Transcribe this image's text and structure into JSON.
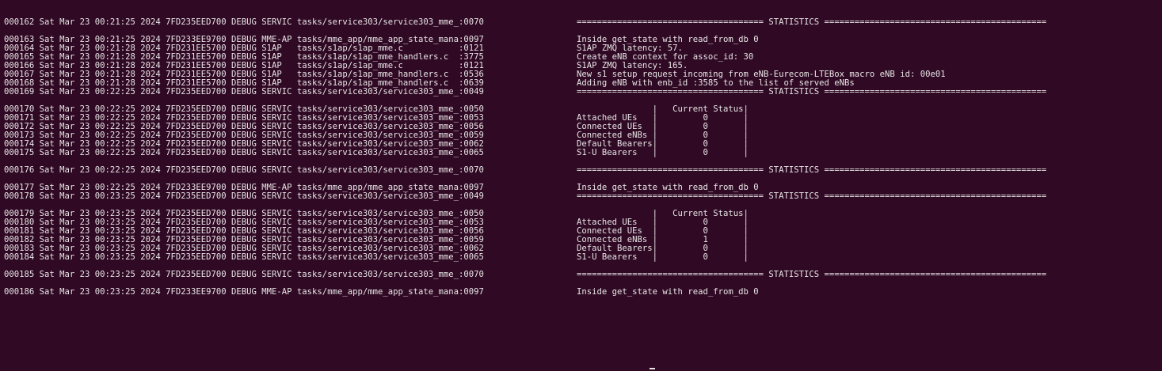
{
  "terminal": {
    "lines": [
      {
        "prefix": "000162 Sat Mar 23 00:21:25 2024 7FD235EED700 DEBUG SERVIC tasks/service303/service303_mme_:0070",
        "msg": "===================================== STATISTICS ============================================"
      },
      {
        "prefix": "",
        "msg": ""
      },
      {
        "prefix": "000163 Sat Mar 23 00:21:25 2024 7FD233EE9700 DEBUG MME-AP tasks/mme_app/mme_app_state_mana:0097",
        "msg": "Inside get_state with read_from_db 0"
      },
      {
        "prefix": "000164 Sat Mar 23 00:21:28 2024 7FD231EE5700 DEBUG S1AP   tasks/s1ap/s1ap_mme.c           :0121",
        "msg": "S1AP ZMQ latency: 57."
      },
      {
        "prefix": "000165 Sat Mar 23 00:21:28 2024 7FD231EE5700 DEBUG S1AP   tasks/s1ap/s1ap_mme_handlers.c  :3775",
        "msg": "Create eNB context for assoc_id: 30"
      },
      {
        "prefix": "000166 Sat Mar 23 00:21:28 2024 7FD231EE5700 DEBUG S1AP   tasks/s1ap/s1ap_mme.c           :0121",
        "msg": "S1AP ZMQ latency: 165."
      },
      {
        "prefix": "000167 Sat Mar 23 00:21:28 2024 7FD231EE5700 DEBUG S1AP   tasks/s1ap/s1ap_mme_handlers.c  :0536",
        "msg": "New s1 setup request incoming from eNB-Eurecom-LTEBox macro eNB id: 00e01"
      },
      {
        "prefix": "000168 Sat Mar 23 00:21:28 2024 7FD231EE5700 DEBUG S1AP   tasks/s1ap/s1ap_mme_handlers.c  :0639",
        "msg": "Adding eNB with enb_id :3585 to the list of served eNBs"
      },
      {
        "prefix": "000169 Sat Mar 23 00:22:25 2024 7FD235EED700 DEBUG SERVIC tasks/service303/service303_mme_:0049",
        "msg": "===================================== STATISTICS ============================================"
      },
      {
        "prefix": "",
        "msg": ""
      },
      {
        "prefix": "000170 Sat Mar 23 00:22:25 2024 7FD235EED700 DEBUG SERVIC tasks/service303/service303_mme_:0050",
        "msg": "               |   Current Status|"
      },
      {
        "prefix": "000171 Sat Mar 23 00:22:25 2024 7FD235EED700 DEBUG SERVIC tasks/service303/service303_mme_:0053",
        "msg": "Attached UEs   |         0       |"
      },
      {
        "prefix": "000172 Sat Mar 23 00:22:25 2024 7FD235EED700 DEBUG SERVIC tasks/service303/service303_mme_:0056",
        "msg": "Connected UEs  |         0       |"
      },
      {
        "prefix": "000173 Sat Mar 23 00:22:25 2024 7FD235EED700 DEBUG SERVIC tasks/service303/service303_mme_:0059",
        "msg": "Connected eNBs |         0       |"
      },
      {
        "prefix": "000174 Sat Mar 23 00:22:25 2024 7FD235EED700 DEBUG SERVIC tasks/service303/service303_mme_:0062",
        "msg": "Default Bearers|         0       |"
      },
      {
        "prefix": "000175 Sat Mar 23 00:22:25 2024 7FD235EED700 DEBUG SERVIC tasks/service303/service303_mme_:0065",
        "msg": "S1-U Bearers   |         0       |"
      },
      {
        "prefix": "",
        "msg": ""
      },
      {
        "prefix": "000176 Sat Mar 23 00:22:25 2024 7FD235EED700 DEBUG SERVIC tasks/service303/service303_mme_:0070",
        "msg": "===================================== STATISTICS ============================================"
      },
      {
        "prefix": "",
        "msg": ""
      },
      {
        "prefix": "000177 Sat Mar 23 00:22:25 2024 7FD233EE9700 DEBUG MME-AP tasks/mme_app/mme_app_state_mana:0097",
        "msg": "Inside get_state with read_from_db 0"
      },
      {
        "prefix": "000178 Sat Mar 23 00:23:25 2024 7FD235EED700 DEBUG SERVIC tasks/service303/service303_mme_:0049",
        "msg": "===================================== STATISTICS ============================================"
      },
      {
        "prefix": "",
        "msg": ""
      },
      {
        "prefix": "000179 Sat Mar 23 00:23:25 2024 7FD235EED700 DEBUG SERVIC tasks/service303/service303_mme_:0050",
        "msg": "               |   Current Status|"
      },
      {
        "prefix": "000180 Sat Mar 23 00:23:25 2024 7FD235EED700 DEBUG SERVIC tasks/service303/service303_mme_:0053",
        "msg": "Attached UEs   |         0       |"
      },
      {
        "prefix": "000181 Sat Mar 23 00:23:25 2024 7FD235EED700 DEBUG SERVIC tasks/service303/service303_mme_:0056",
        "msg": "Connected UEs  |         0       |"
      },
      {
        "prefix": "000182 Sat Mar 23 00:23:25 2024 7FD235EED700 DEBUG SERVIC tasks/service303/service303_mme_:0059",
        "msg": "Connected eNBs |         1       |"
      },
      {
        "prefix": "000183 Sat Mar 23 00:23:25 2024 7FD235EED700 DEBUG SERVIC tasks/service303/service303_mme_:0062",
        "msg": "Default Bearers|         0       |"
      },
      {
        "prefix": "000184 Sat Mar 23 00:23:25 2024 7FD235EED700 DEBUG SERVIC tasks/service303/service303_mme_:0065",
        "msg": "S1-U Bearers   |         0       |"
      },
      {
        "prefix": "",
        "msg": ""
      },
      {
        "prefix": "000185 Sat Mar 23 00:23:25 2024 7FD235EED700 DEBUG SERVIC tasks/service303/service303_mme_:0070",
        "msg": "===================================== STATISTICS ============================================"
      },
      {
        "prefix": "",
        "msg": ""
      },
      {
        "prefix": "000186 Sat Mar 23 00:23:25 2024 7FD233EE9700 DEBUG MME-AP tasks/mme_app/mme_app_state_mana:0097",
        "msg": "Inside get_state with read_from_db 0"
      }
    ]
  },
  "colors": {
    "background": "#300a24",
    "text": "#e8e4e6"
  }
}
